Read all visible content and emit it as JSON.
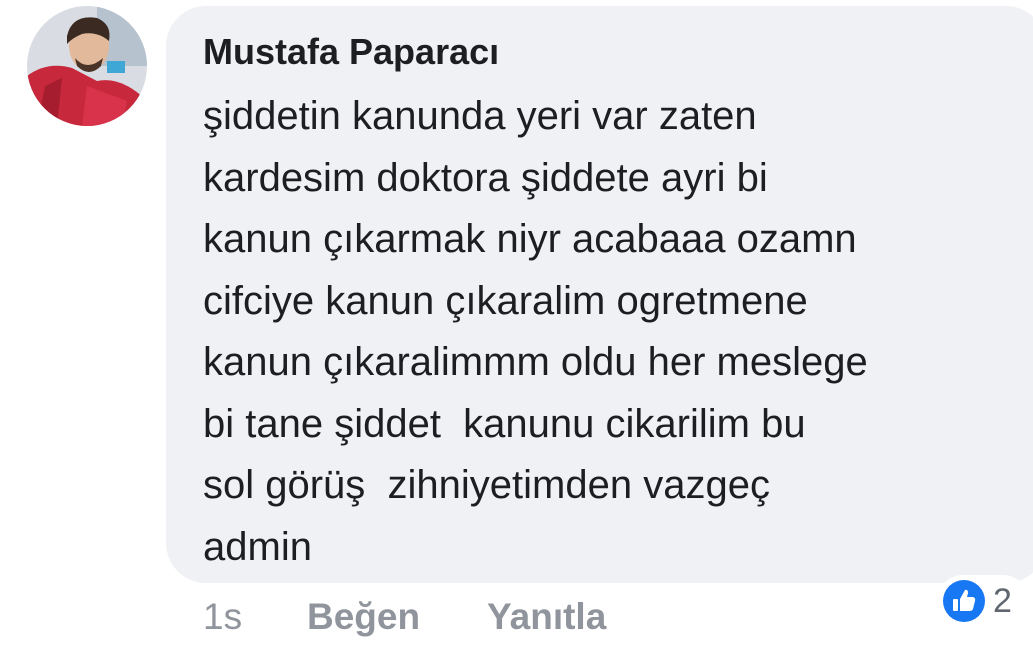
{
  "comment": {
    "author": "Mustafa Paparacı",
    "lines": [
      "şiddetin kanunda yeri var zaten",
      "kardesim doktora şiddete ayri bi",
      "kanun çıkarmak niyr acabaaa ozamn",
      "cifciye kanun çıkaralim ogretmene",
      "kanun çıkaralimmm oldu her meslege",
      "bi tane şiddet  kanunu cikarilim bu",
      "sol görüş  zihniyetimden vazgeç",
      "admin"
    ],
    "time": "1s",
    "like_label": "Beğen",
    "reply_label": "Yanıtla",
    "reaction_icon": "thumbs-up-icon",
    "reaction_count": "2"
  },
  "colors": {
    "bubble": "#f0f1f4",
    "like_blue": "#1877f2",
    "text": "#1c1e21",
    "muted": "#90949c"
  }
}
